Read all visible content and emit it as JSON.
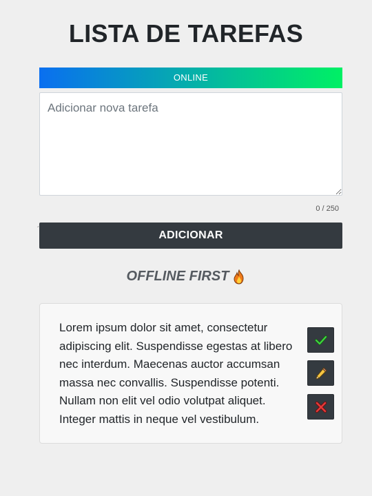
{
  "header": {
    "title": "LISTA DE TAREFAS"
  },
  "status": {
    "label": "ONLINE",
    "color_start": "#0a6ff0",
    "color_end": "#00f064"
  },
  "new_task": {
    "placeholder": "Adicionar nova tarefa",
    "value": "",
    "counter": "0 / 250"
  },
  "add_button": {
    "label": "ADICIONAR"
  },
  "section": {
    "heading": "OFFLINE FIRST",
    "icon": "fire-icon"
  },
  "tasks": [
    {
      "text": "Lorem ipsum dolor sit amet, consectetur adipiscing elit. Suspendisse egestas at libero nec interdum. Maecenas auctor accumsan massa nec convallis. Suspendisse potenti. Nullam non elit vel odio volutpat aliquet. Integer mattis in neque vel vestibulum.",
      "actions": [
        "check-icon",
        "pencil-icon",
        "cross-icon"
      ]
    }
  ]
}
